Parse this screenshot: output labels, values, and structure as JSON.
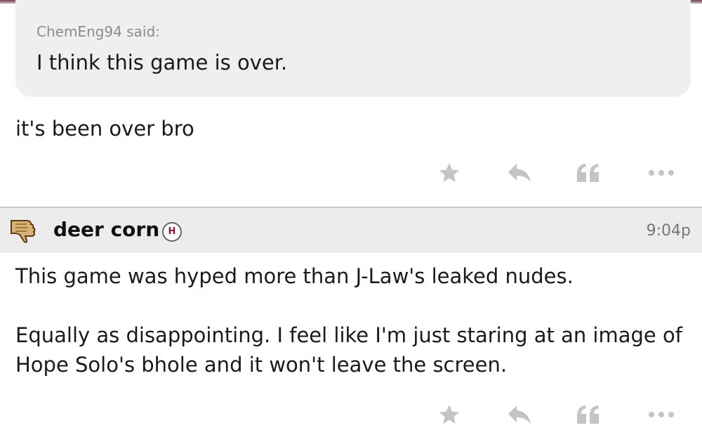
{
  "quote": {
    "author": "ChemEng94 said:",
    "text": "I think this game is over."
  },
  "posts": [
    {
      "body": "it's been over bro"
    },
    {
      "username": "deer corn",
      "badge": "H",
      "time": "9:04p",
      "body": [
        "This game was hyped more than J-Law's leaked nudes.",
        "Equally as disappointing. I feel like I'm just staring at an image of Hope Solo's bhole and it won't leave the screen."
      ]
    }
  ],
  "icons": {
    "like": "star-icon",
    "reply": "reply-arrow-icon",
    "quote": "quote-icon",
    "more": "more-dots-icon",
    "avatar": "thumbs-down-avatar"
  },
  "colors": {
    "accent": "#7a3f58",
    "icon_gray": "#c4c4c4",
    "header_bg": "#ececec",
    "quote_bg": "#efefef",
    "badge_text": "#7b1a2c"
  }
}
